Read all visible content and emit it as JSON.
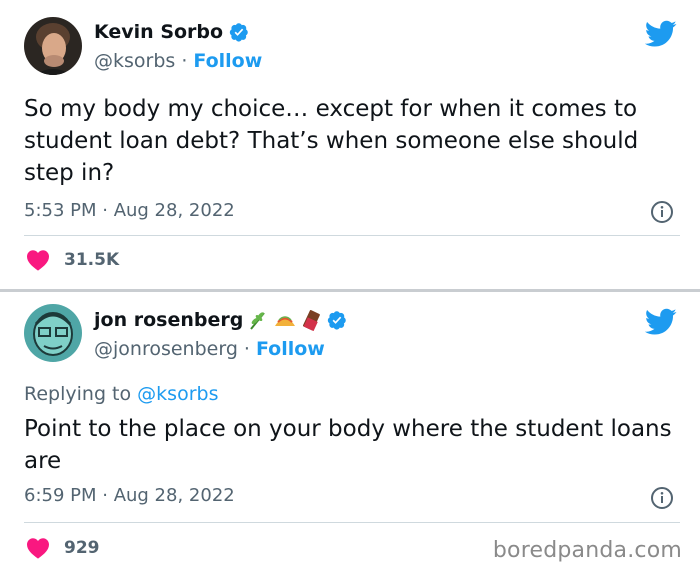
{
  "tweets": [
    {
      "display_name": "Kevin Sorbo",
      "handle": "@ksorbs",
      "follow_label": "Follow",
      "text": "So my body my choice… except for when it comes to student loan debt? That’s when someone else should step in?",
      "timestamp": "5:53 PM · Aug 28, 2022",
      "likes": "31.5K",
      "icons": {
        "verified": "verified-badge-icon",
        "brand": "twitter-bird-icon",
        "info": "info-icon",
        "like": "heart-icon"
      }
    },
    {
      "display_name": "jon rosenberg",
      "name_emojis": [
        "🌿",
        "🌮",
        "🍫"
      ],
      "handle": "@jonrosenberg",
      "follow_label": "Follow",
      "replying_prefix": "Replying to",
      "replying_to": "@ksorbs",
      "text": "Point to the place on your body where the student loans are",
      "timestamp": "6:59 PM · Aug 28, 2022",
      "likes": "929",
      "icons": {
        "verified": "verified-badge-icon",
        "brand": "twitter-bird-icon",
        "info": "info-icon",
        "like": "heart-icon"
      }
    }
  ],
  "handle_separator": "·",
  "watermark": "boredpanda.com",
  "colors": {
    "accent": "#1d9bf0",
    "like": "#f91880",
    "secondary_text": "#536471"
  }
}
